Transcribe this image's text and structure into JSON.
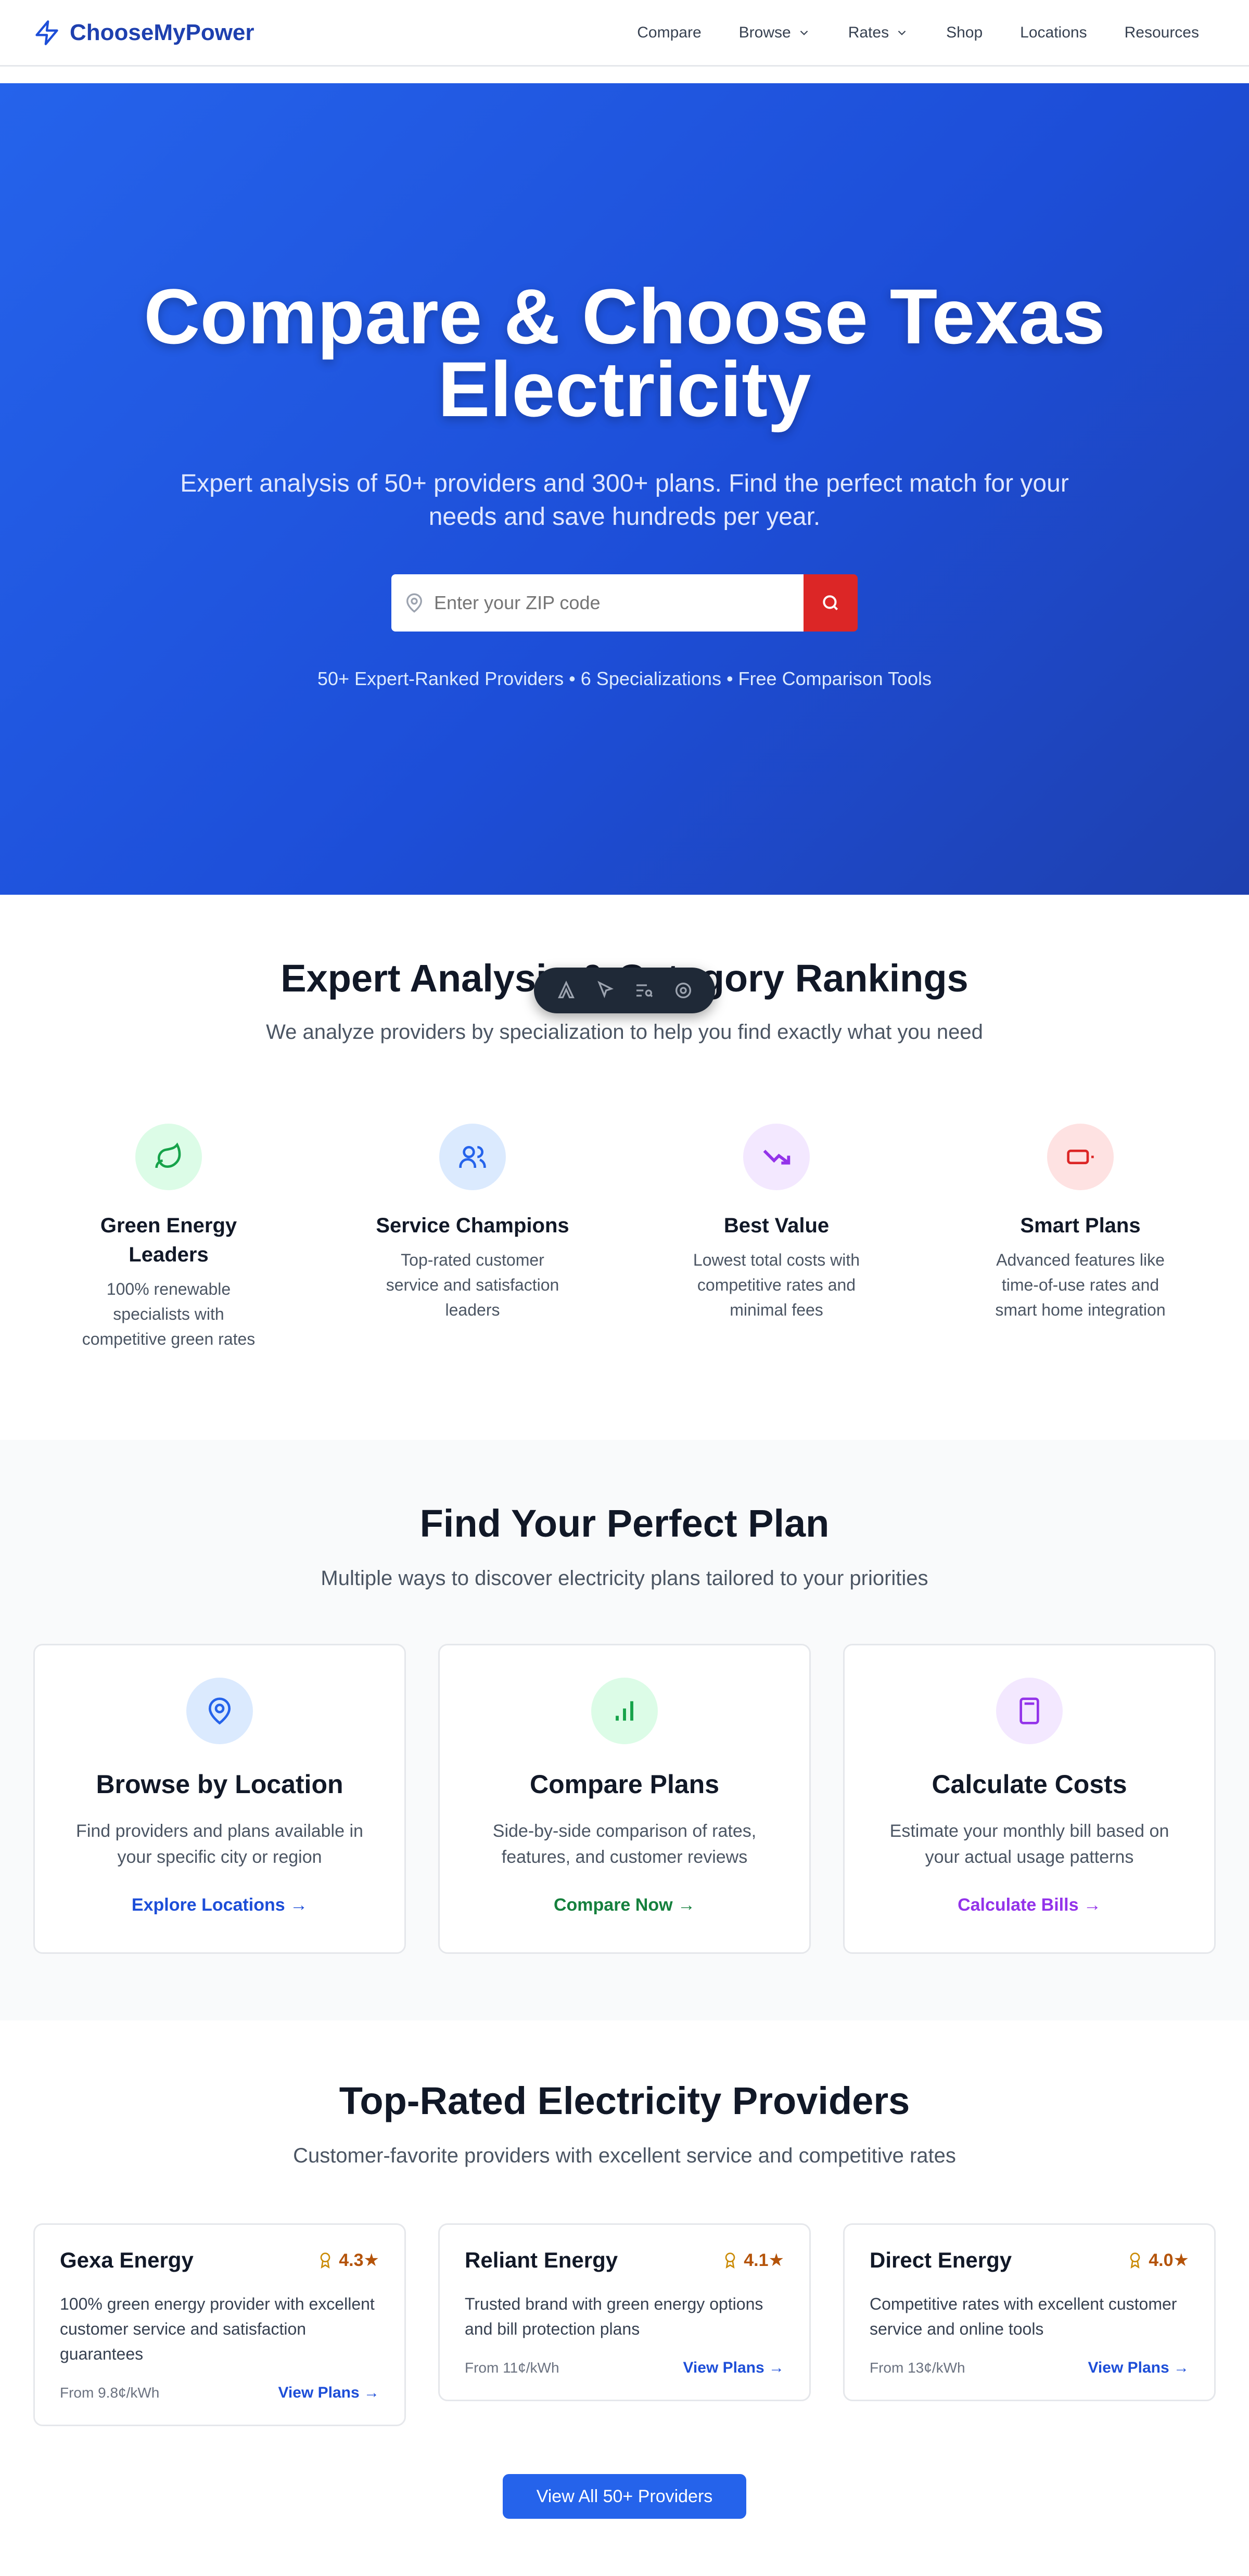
{
  "nav": {
    "brand": "ChooseMyPower",
    "links": [
      {
        "label": "Compare"
      },
      {
        "label": "Browse"
      },
      {
        "label": "Rates"
      },
      {
        "label": "Shop"
      },
      {
        "label": "Locations"
      },
      {
        "label": "Resources"
      }
    ]
  },
  "hero": {
    "title_line1": "Compare & Choose Texas",
    "title_line2": "Electricity",
    "subtitle": "Expert analysis of 50+ providers and 300+ plans. Find the perfect match for your needs and save hundreds per year.",
    "zip_placeholder": "Enter your ZIP code",
    "stats": "50+ Expert-Ranked Providers • 6 Specializations • Free Comparison Tools"
  },
  "analysis": {
    "title": "Expert Analysis & Category Rankings",
    "subtitle": "We analyze providers by specialization to help you find exactly what you need",
    "categories": [
      {
        "title": "Green Energy Leaders",
        "desc": "100% renewable specialists with competitive green rates",
        "icon": "leaf-icon"
      },
      {
        "title": "Service Champions",
        "desc": "Top-rated customer service and satisfaction leaders",
        "icon": "users-icon"
      },
      {
        "title": "Best Value",
        "desc": "Lowest total costs with competitive rates and minimal fees",
        "icon": "trending-down-icon"
      },
      {
        "title": "Smart Plans",
        "desc": "Advanced features like time-of-use rates and smart home integration",
        "icon": "battery-icon"
      }
    ]
  },
  "find": {
    "title": "Find Your Perfect Plan",
    "subtitle": "Multiple ways to discover electricity plans tailored to your priorities",
    "cards": [
      {
        "title": "Browse by Location",
        "desc": "Find providers and plans available in your specific city or region",
        "link": "Explore Locations →",
        "icon": "map-pin-icon"
      },
      {
        "title": "Compare Plans",
        "desc": "Side-by-side comparison of rates, features, and customer reviews",
        "link": "Compare Now →",
        "icon": "bar-chart-icon"
      },
      {
        "title": "Calculate Costs",
        "desc": "Estimate your monthly bill based on your actual usage patterns",
        "link": "Calculate Bills →",
        "icon": "calculator-icon"
      }
    ]
  },
  "providers": {
    "title": "Top-Rated Electricity Providers",
    "subtitle": "Customer-favorite providers with excellent service and competitive rates",
    "items": [
      {
        "name": "Gexa Energy",
        "rating": "4.3★",
        "desc": "100% green energy provider with excellent customer service and satisfaction guarantees",
        "price": "From 9.8¢/kWh",
        "link": "View Plans →"
      },
      {
        "name": "Reliant Energy",
        "rating": "4.1★",
        "desc": "Trusted brand with green energy options and bill protection plans",
        "price": "From 11¢/kWh",
        "link": "View Plans →"
      },
      {
        "name": "Direct Energy",
        "rating": "4.0★",
        "desc": "Competitive rates with excellent customer service and online tools",
        "price": "From 13¢/kWh",
        "link": "View Plans →"
      }
    ],
    "view_all": "View All 50+ Providers"
  },
  "colors": {
    "primary": "#2563eb",
    "brand": "#1e40af",
    "search_button": "#dc2626",
    "green": "#16a34a",
    "purple": "#9333ea",
    "red": "#dc2626"
  }
}
